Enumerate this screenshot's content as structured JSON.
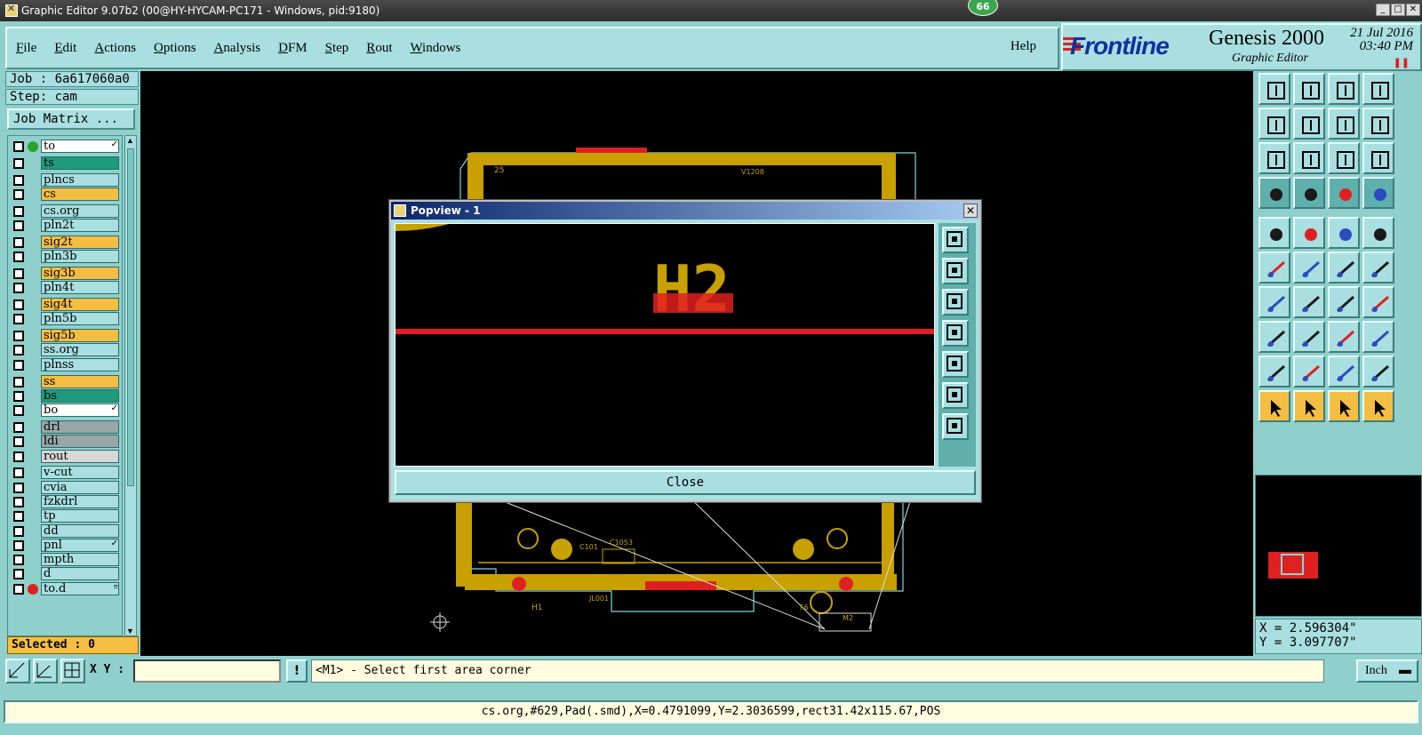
{
  "window": {
    "title": "Graphic Editor 9.07b2 (00@HY-HYCAM-PC171 - Windows, pid:9180)",
    "badge": "66"
  },
  "menu": {
    "items": [
      "File",
      "Edit",
      "Actions",
      "Options",
      "Analysis",
      "DFM",
      "Step",
      "Rout",
      "Windows"
    ],
    "help": "Help"
  },
  "brand": {
    "logo": "Frontline",
    "product": "Genesis 2000",
    "subtitle": "Graphic Editor",
    "date": "21 Jul 2016",
    "time": "03:40 PM"
  },
  "job": {
    "job_label": "Job : 6a617060a0",
    "step_label": "Step: cam",
    "matrix_button": "Job Matrix ..."
  },
  "layers": [
    {
      "name": "to",
      "color": "#ffffff",
      "dot": "#2ca02c",
      "mark": "✓"
    },
    {
      "name": "ts",
      "color": "#1e9b7a",
      "dot": "",
      "mark": ""
    },
    {
      "name": "plncs",
      "color": "#a9dfe0",
      "dot": "",
      "mark": ""
    },
    {
      "name": "cs",
      "color": "#f4be42",
      "dot": "",
      "mark": ""
    },
    {
      "name": "cs.org",
      "color": "#a9dfe0",
      "dot": "",
      "mark": ""
    },
    {
      "name": "pln2t",
      "color": "#a9dfe0",
      "dot": "",
      "mark": ""
    },
    {
      "name": "sig2t",
      "color": "#f4be42",
      "dot": "",
      "mark": ""
    },
    {
      "name": "pln3b",
      "color": "#a9dfe0",
      "dot": "",
      "mark": ""
    },
    {
      "name": "sig3b",
      "color": "#f4be42",
      "dot": "",
      "mark": ""
    },
    {
      "name": "pln4t",
      "color": "#a9dfe0",
      "dot": "",
      "mark": ""
    },
    {
      "name": "sig4t",
      "color": "#f4be42",
      "dot": "",
      "mark": ""
    },
    {
      "name": "pln5b",
      "color": "#a9dfe0",
      "dot": "",
      "mark": ""
    },
    {
      "name": "sig5b",
      "color": "#f4be42",
      "dot": "",
      "mark": ""
    },
    {
      "name": "ss.org",
      "color": "#a9dfe0",
      "dot": "",
      "mark": ""
    },
    {
      "name": "plnss",
      "color": "#a9dfe0",
      "dot": "",
      "mark": ""
    },
    {
      "name": "ss",
      "color": "#f4be42",
      "dot": "",
      "mark": ""
    },
    {
      "name": "bs",
      "color": "#1e9b7a",
      "dot": "",
      "mark": ""
    },
    {
      "name": "bo",
      "color": "#ffffff",
      "dot": "",
      "mark": "✓"
    },
    {
      "name": "drl",
      "color": "#9aa6a6",
      "dot": "",
      "mark": ""
    },
    {
      "name": "ldi",
      "color": "#9aa6a6",
      "dot": "",
      "mark": ""
    },
    {
      "name": "rout",
      "color": "#d8d8d8",
      "dot": "",
      "mark": ""
    },
    {
      "name": "v-cut",
      "color": "#a9dfe0",
      "dot": "",
      "mark": ""
    },
    {
      "name": "cvia",
      "color": "#a9dfe0",
      "dot": "",
      "mark": ""
    },
    {
      "name": "fzkdrl",
      "color": "#a9dfe0",
      "dot": "",
      "mark": ""
    },
    {
      "name": "tp",
      "color": "#a9dfe0",
      "dot": "",
      "mark": ""
    },
    {
      "name": "dd",
      "color": "#a9dfe0",
      "dot": "",
      "mark": ""
    },
    {
      "name": "pnl",
      "color": "#a9dfe0",
      "dot": "",
      "mark": "✓"
    },
    {
      "name": "mpth",
      "color": "#a9dfe0",
      "dot": "",
      "mark": ""
    },
    {
      "name": "d",
      "color": "#a9dfe0",
      "dot": "",
      "mark": ""
    },
    {
      "name": "to.d",
      "color": "#a9dfe0",
      "dot": "#e02020",
      "mark": "≡"
    }
  ],
  "selected": "Selected : 0",
  "coords": {
    "x": "X = 2.596304\"",
    "y": "Y = 3.097707\""
  },
  "bottom": {
    "xy_label": "X Y :",
    "xy_value": "",
    "warn": "!",
    "prompt": "<M1> - Select first area corner",
    "units": "Inch"
  },
  "status": "cs.org,#629,Pad(.smd),X=0.4791099,Y=2.3036599,rect31.42x115.67,POS",
  "popview": {
    "title": "Popview - 1",
    "label": "H2",
    "close": "Close"
  },
  "board_labels": {
    "h1": "H1",
    "jl001": "JL001",
    "c1053": "C1053",
    "c101": "C101",
    "v1208": "V1208",
    "n25": "25",
    "f6": "F6",
    "m2": "M2"
  },
  "colors": {
    "copper": "#c8a000",
    "pad": "#e02020",
    "outline": "#7fd8d8",
    "panel": "#8fd0cc"
  }
}
